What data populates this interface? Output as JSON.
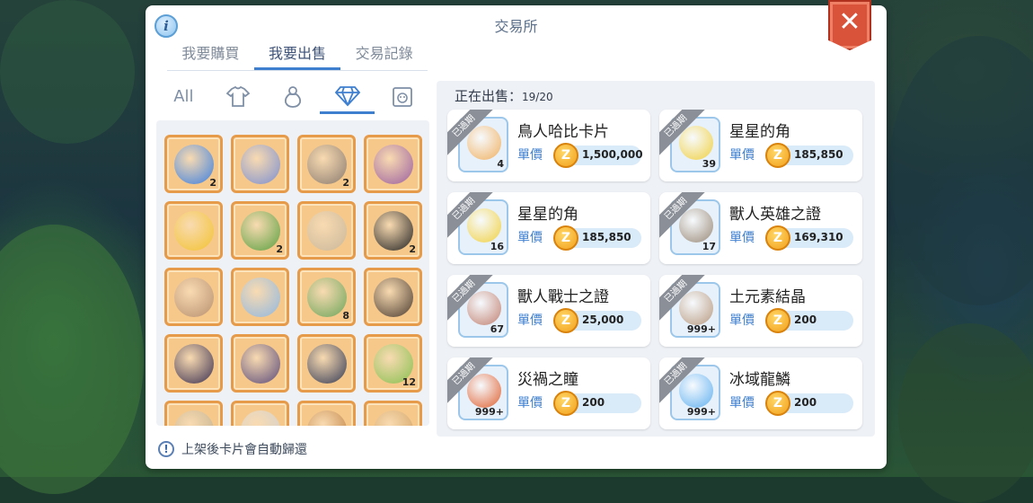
{
  "window": {
    "title": "交易所"
  },
  "tabs": [
    {
      "label": "我要購買",
      "active": false
    },
    {
      "label": "我要出售",
      "active": true
    },
    {
      "label": "交易記錄",
      "active": false
    }
  ],
  "categories": [
    {
      "label": "All",
      "icon": "all-text"
    },
    {
      "label": "",
      "icon": "armor-icon"
    },
    {
      "label": "",
      "icon": "potion-icon"
    },
    {
      "label": "",
      "icon": "diamond-icon",
      "active": true
    },
    {
      "label": "",
      "icon": "card-icon"
    }
  ],
  "inventory": [
    {
      "name": "blue-flame-item",
      "count": "2",
      "color": "#3c7fe0"
    },
    {
      "name": "wing-item",
      "count": "",
      "color": "#7c8fd0"
    },
    {
      "name": "rock-shard-item",
      "count": "2",
      "color": "#8a7b70"
    },
    {
      "name": "feather-leaf-item",
      "count": "",
      "color": "#9b5fa0"
    },
    {
      "name": "chick-item",
      "count": "",
      "color": "#f2c230"
    },
    {
      "name": "herb-item",
      "count": "2",
      "color": "#5aa040"
    },
    {
      "name": "stick-item",
      "count": "",
      "color": "#c9b79a"
    },
    {
      "name": "black-belt-item",
      "count": "2",
      "color": "#222222"
    },
    {
      "name": "ring-item",
      "count": "",
      "color": "#b89070"
    },
    {
      "name": "umbrella-item",
      "count": "",
      "color": "#8fb7e0"
    },
    {
      "name": "leafy-plant-item",
      "count": "8",
      "color": "#6ba55a"
    },
    {
      "name": "horn-mask-item",
      "count": "",
      "color": "#4a3b30"
    },
    {
      "name": "moon-item",
      "count": "",
      "color": "#3a2f50"
    },
    {
      "name": "witch-hat-item",
      "count": "",
      "color": "#5a4a7a"
    },
    {
      "name": "dark-blade-item",
      "count": "",
      "color": "#333a55"
    },
    {
      "name": "green-sprout-item",
      "count": "12",
      "color": "#88c050"
    },
    {
      "name": "partial-item-1",
      "count": "",
      "color": "#c0b090"
    },
    {
      "name": "partial-item-2",
      "count": "",
      "color": "#d0d0d0"
    },
    {
      "name": "partial-item-3",
      "count": "",
      "color": "#c08040"
    },
    {
      "name": "partial-item-4",
      "count": "",
      "color": "#d0a060"
    }
  ],
  "selling": {
    "label": "正在出售：",
    "count": "19/20",
    "price_label": "單價",
    "status_text": "已過期",
    "items": [
      {
        "name": "鳥人哈比卡片",
        "qty": "4",
        "price": "1,500,000",
        "color": "#f0b060"
      },
      {
        "name": "星星的角",
        "qty": "39",
        "price": "185,850",
        "color": "#f0d040"
      },
      {
        "name": "星星的角",
        "qty": "16",
        "price": "185,850",
        "color": "#f0d040"
      },
      {
        "name": "獸人英雄之證",
        "qty": "17",
        "price": "169,310",
        "color": "#9a8a78"
      },
      {
        "name": "獸人戰士之證",
        "qty": "67",
        "price": "25,000",
        "color": "#c08070"
      },
      {
        "name": "土元素結晶",
        "qty": "999+",
        "price": "200",
        "color": "#b89a80"
      },
      {
        "name": "災禍之瞳",
        "qty": "999+",
        "price": "200",
        "color": "#e06030"
      },
      {
        "name": "冰域龍鱗",
        "qty": "999+",
        "price": "200",
        "color": "#60b0f0"
      }
    ]
  },
  "footer": {
    "note": "上架後卡片會自動歸還"
  },
  "colors": {
    "accent": "#3e7fd0",
    "close": "#d9533b",
    "slot_border": "#e69b4a"
  }
}
